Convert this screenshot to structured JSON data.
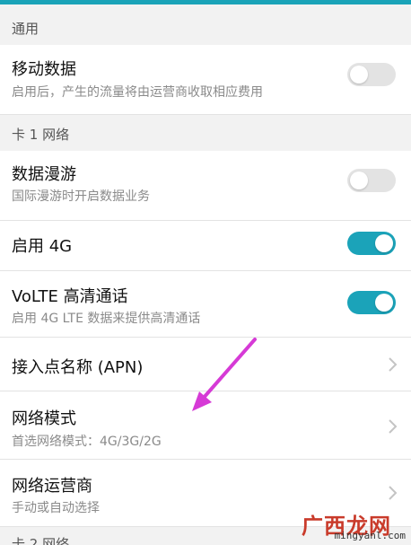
{
  "sections": {
    "general": {
      "header": "通用"
    },
    "sim1": {
      "header": "卡 1 网络"
    },
    "next": {
      "header": "卡 2 网络"
    }
  },
  "rows": {
    "mobile_data": {
      "title": "移动数据",
      "subtitle": "启用后，产生的流量将由运营商收取相应费用",
      "toggle_on": false
    },
    "data_roaming": {
      "title": "数据漫游",
      "subtitle": "国际漫游时开启数据业务",
      "toggle_on": false
    },
    "enable_4g": {
      "title": "启用 4G",
      "toggle_on": true
    },
    "volte": {
      "title": "VoLTE 高清通话",
      "subtitle": "启用 4G LTE 数据来提供高清通话",
      "toggle_on": true
    },
    "apn": {
      "title": "接入点名称 (APN)"
    },
    "network_mode": {
      "title": "网络模式",
      "subtitle": "首选网络模式：4G/3G/2G"
    },
    "carrier": {
      "title": "网络运营商",
      "subtitle": "手动或自动选择"
    }
  },
  "watermark": {
    "text": "广西龙网",
    "url": "mingyanl.com"
  },
  "colors": {
    "accent": "#1ba3b9",
    "annotation_arrow": "#d63ad6"
  },
  "icons": {
    "chevron": "chevron-right-icon"
  }
}
